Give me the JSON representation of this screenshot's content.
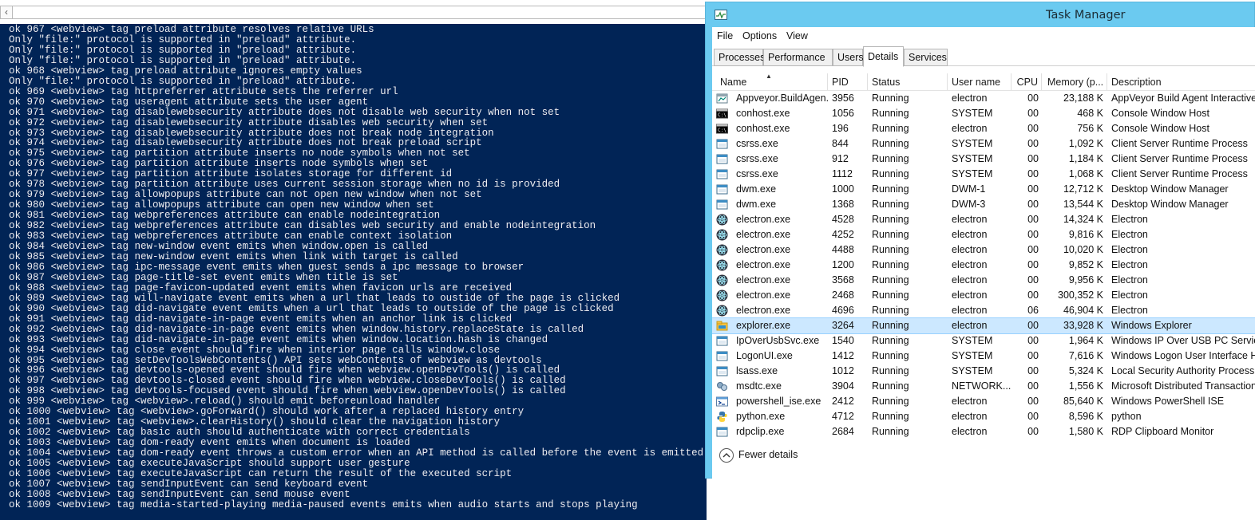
{
  "console": {
    "lines": [
      "ok 967 <webview> tag preload attribute resolves relative URLs",
      "Only \"file:\" protocol is supported in \"preload\" attribute.",
      "Only \"file:\" protocol is supported in \"preload\" attribute.",
      "Only \"file:\" protocol is supported in \"preload\" attribute.",
      "ok 968 <webview> tag preload attribute ignores empty values",
      "Only \"file:\" protocol is supported in \"preload\" attribute.",
      "ok 969 <webview> tag httpreferrer attribute sets the referrer url",
      "ok 970 <webview> tag useragent attribute sets the user agent",
      "ok 971 <webview> tag disablewebsecurity attribute does not disable web security when not set",
      "ok 972 <webview> tag disablewebsecurity attribute disables web security when set",
      "ok 973 <webview> tag disablewebsecurity attribute does not break node integration",
      "ok 974 <webview> tag disablewebsecurity attribute does not break preload script",
      "ok 975 <webview> tag partition attribute inserts no node symbols when not set",
      "ok 976 <webview> tag partition attribute inserts node symbols when set",
      "ok 977 <webview> tag partition attribute isolates storage for different id",
      "ok 978 <webview> tag partition attribute uses current session storage when no id is provided",
      "ok 979 <webview> tag allowpopups attribute can not open new window when not set",
      "ok 980 <webview> tag allowpopups attribute can open new window when set",
      "ok 981 <webview> tag webpreferences attribute can enable nodeintegration",
      "ok 982 <webview> tag webpreferences attribute can disables web security and enable nodeintegration",
      "ok 983 <webview> tag webpreferences attribute can enable context isolation",
      "ok 984 <webview> tag new-window event emits when window.open is called",
      "ok 985 <webview> tag new-window event emits when link with target is called",
      "ok 986 <webview> tag ipc-message event emits when guest sends a ipc message to browser",
      "ok 987 <webview> tag page-title-set event emits when title is set",
      "ok 988 <webview> tag page-favicon-updated event emits when favicon urls are received",
      "ok 989 <webview> tag will-navigate event emits when a url that leads to oustide of the page is clicked",
      "ok 990 <webview> tag did-navigate event emits when a url that leads to outside of the page is clicked",
      "ok 991 <webview> tag did-navigate-in-page event emits when an anchor link is clicked",
      "ok 992 <webview> tag did-navigate-in-page event emits when window.history.replaceState is called",
      "ok 993 <webview> tag did-navigate-in-page event emits when window.location.hash is changed",
      "ok 994 <webview> tag close event should fire when interior page calls window.close",
      "ok 995 <webview> tag setDevToolsWebContents() API sets webContents of webview as devtools",
      "ok 996 <webview> tag devtools-opened event should fire when webview.openDevTools() is called",
      "ok 997 <webview> tag devtools-closed event should fire when webview.closeDevTools() is called",
      "ok 998 <webview> tag devtools-focused event should fire when webview.openDevTools() is called",
      "ok 999 <webview> tag <webview>.reload() should emit beforeunload handler",
      "ok 1000 <webview> tag <webview>.goForward() should work after a replaced history entry",
      "ok 1001 <webview> tag <webview>.clearHistory() should clear the navigation history",
      "ok 1002 <webview> tag basic auth should authenticate with correct credentials",
      "ok 1003 <webview> tag dom-ready event emits when document is loaded",
      "ok 1004 <webview> tag dom-ready event throws a custom error when an API method is called before the event is emitted",
      "ok 1005 <webview> tag executeJavaScript should support user gesture",
      "ok 1006 <webview> tag executeJavaScript can return the result of the executed script",
      "ok 1007 <webview> tag sendInputEvent can send keyboard event",
      "ok 1008 <webview> tag sendInputEvent can send mouse event",
      "ok 1009 <webview> tag media-started-playing media-paused events emits when audio starts and stops playing"
    ]
  },
  "taskmanager": {
    "title": "Task Manager",
    "menu": [
      "File",
      "Options",
      "View"
    ],
    "tabs": [
      "Processes",
      "Performance",
      "Users",
      "Details",
      "Services"
    ],
    "active_tab": "Details",
    "columns": [
      "Name",
      "PID",
      "Status",
      "User name",
      "CPU",
      "Memory (p...",
      "Description"
    ],
    "sorted_column": "Name",
    "rows": [
      {
        "name": "Appveyor.BuildAgen...",
        "pid": "3956",
        "status": "Running",
        "user": "electron",
        "cpu": "00",
        "mem": "23,188 K",
        "desc": "AppVeyor Build Agent Interactive",
        "icon": "appveyor-icon"
      },
      {
        "name": "conhost.exe",
        "pid": "1056",
        "status": "Running",
        "user": "SYSTEM",
        "cpu": "00",
        "mem": "468 K",
        "desc": "Console Window Host",
        "icon": "console-icon"
      },
      {
        "name": "conhost.exe",
        "pid": "196",
        "status": "Running",
        "user": "electron",
        "cpu": "00",
        "mem": "756 K",
        "desc": "Console Window Host",
        "icon": "console-icon"
      },
      {
        "name": "csrss.exe",
        "pid": "844",
        "status": "Running",
        "user": "SYSTEM",
        "cpu": "00",
        "mem": "1,092 K",
        "desc": "Client Server Runtime Process",
        "icon": "system-process-icon"
      },
      {
        "name": "csrss.exe",
        "pid": "912",
        "status": "Running",
        "user": "SYSTEM",
        "cpu": "00",
        "mem": "1,184 K",
        "desc": "Client Server Runtime Process",
        "icon": "system-process-icon"
      },
      {
        "name": "csrss.exe",
        "pid": "1112",
        "status": "Running",
        "user": "SYSTEM",
        "cpu": "00",
        "mem": "1,068 K",
        "desc": "Client Server Runtime Process",
        "icon": "system-process-icon"
      },
      {
        "name": "dwm.exe",
        "pid": "1000",
        "status": "Running",
        "user": "DWM-1",
        "cpu": "00",
        "mem": "12,712 K",
        "desc": "Desktop Window Manager",
        "icon": "system-process-icon"
      },
      {
        "name": "dwm.exe",
        "pid": "1368",
        "status": "Running",
        "user": "DWM-3",
        "cpu": "00",
        "mem": "13,544 K",
        "desc": "Desktop Window Manager",
        "icon": "system-process-icon"
      },
      {
        "name": "electron.exe",
        "pid": "4528",
        "status": "Running",
        "user": "electron",
        "cpu": "00",
        "mem": "14,324 K",
        "desc": "Electron",
        "icon": "electron-icon"
      },
      {
        "name": "electron.exe",
        "pid": "4252",
        "status": "Running",
        "user": "electron",
        "cpu": "00",
        "mem": "9,816 K",
        "desc": "Electron",
        "icon": "electron-icon"
      },
      {
        "name": "electron.exe",
        "pid": "4488",
        "status": "Running",
        "user": "electron",
        "cpu": "00",
        "mem": "10,020 K",
        "desc": "Electron",
        "icon": "electron-icon"
      },
      {
        "name": "electron.exe",
        "pid": "1200",
        "status": "Running",
        "user": "electron",
        "cpu": "00",
        "mem": "9,852 K",
        "desc": "Electron",
        "icon": "electron-icon"
      },
      {
        "name": "electron.exe",
        "pid": "3568",
        "status": "Running",
        "user": "electron",
        "cpu": "00",
        "mem": "9,956 K",
        "desc": "Electron",
        "icon": "electron-icon"
      },
      {
        "name": "electron.exe",
        "pid": "2468",
        "status": "Running",
        "user": "electron",
        "cpu": "00",
        "mem": "300,352 K",
        "desc": "Electron",
        "icon": "electron-icon"
      },
      {
        "name": "electron.exe",
        "pid": "4696",
        "status": "Running",
        "user": "electron",
        "cpu": "06",
        "mem": "46,904 K",
        "desc": "Electron",
        "icon": "electron-icon"
      },
      {
        "name": "explorer.exe",
        "pid": "3264",
        "status": "Running",
        "user": "electron",
        "cpu": "00",
        "mem": "33,928 K",
        "desc": "Windows Explorer",
        "icon": "explorer-icon",
        "selected": true
      },
      {
        "name": "IpOverUsbSvc.exe",
        "pid": "1540",
        "status": "Running",
        "user": "SYSTEM",
        "cpu": "00",
        "mem": "1,964 K",
        "desc": "Windows IP Over USB PC Service",
        "icon": "system-process-icon"
      },
      {
        "name": "LogonUI.exe",
        "pid": "1412",
        "status": "Running",
        "user": "SYSTEM",
        "cpu": "00",
        "mem": "7,616 K",
        "desc": "Windows Logon User Interface Ho",
        "icon": "system-process-icon"
      },
      {
        "name": "lsass.exe",
        "pid": "1012",
        "status": "Running",
        "user": "SYSTEM",
        "cpu": "00",
        "mem": "5,324 K",
        "desc": "Local Security Authority Process",
        "icon": "system-process-icon"
      },
      {
        "name": "msdtc.exe",
        "pid": "3904",
        "status": "Running",
        "user": "NETWORK...",
        "cpu": "00",
        "mem": "1,556 K",
        "desc": "Microsoft Distributed Transaction",
        "icon": "msdtc-icon"
      },
      {
        "name": "powershell_ise.exe",
        "pid": "2412",
        "status": "Running",
        "user": "electron",
        "cpu": "00",
        "mem": "85,640 K",
        "desc": "Windows PowerShell ISE",
        "icon": "powershell-ise-icon"
      },
      {
        "name": "python.exe",
        "pid": "4712",
        "status": "Running",
        "user": "electron",
        "cpu": "00",
        "mem": "8,596 K",
        "desc": "python",
        "icon": "python-icon"
      },
      {
        "name": "rdpclip.exe",
        "pid": "2684",
        "status": "Running",
        "user": "electron",
        "cpu": "00",
        "mem": "1,580 K",
        "desc": "RDP Clipboard Monitor",
        "icon": "system-process-icon"
      }
    ],
    "footer": {
      "label": "Fewer details"
    }
  },
  "colors": {
    "console_bg": "#012456",
    "console_text": "#eeedf0",
    "titlebar": "#6bcaf0",
    "selected_row": "#cce8ff"
  }
}
